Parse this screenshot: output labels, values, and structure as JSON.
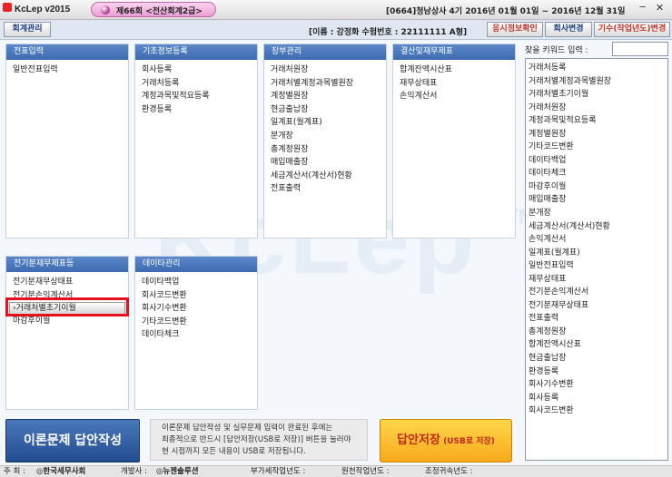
{
  "window": {
    "app_title": "KcLep v2015",
    "exam_tab": "제66회 <전산회계2급>",
    "company_info": "[0664]청남상사 4기 2016년 01월 01일 ~ 2016년 12월 31일",
    "minimize_symbol": "─",
    "close_symbol": "✕"
  },
  "toolbar": {
    "mgmt_button": "회계관리",
    "user_info": "[이름 : 강정화  수험번호 : 22111111  A형]",
    "applicant_button": "응시정보확인",
    "company_button": "회사변경",
    "period_button": "기수(작업년도)변경"
  },
  "panels": {
    "voucher": {
      "title": "전표입력",
      "items": [
        "일반전표입력"
      ]
    },
    "basic": {
      "title": "기초정보등록",
      "items": [
        "회사등록",
        "거래처등록",
        "계정과목및적요등록",
        "환경등록"
      ]
    },
    "ledger": {
      "title": "장부관리",
      "items": [
        "거래처원장",
        "거래처별계정과목별원장",
        "계정별원장",
        "현금출납장",
        "일계표(월계표)",
        "분개장",
        "총계정원장",
        "매입매출장",
        "세금계산서(계산서)현황",
        "전표출력"
      ]
    },
    "closing": {
      "title": "결산및재무제표",
      "items": [
        "합계잔액시산표",
        "재무상태표",
        "손익계산서"
      ]
    },
    "prior": {
      "title": "전기분재무제표등",
      "items": [
        "전기분재무상태표",
        "전기분손익계산서",
        "›거래처별초기이월",
        "마감후이월"
      ]
    },
    "data": {
      "title": "데이타관리",
      "items": [
        "데이타백업",
        "회사코드변환",
        "회사기수변환",
        "기타코드변환",
        "데이타체크"
      ]
    }
  },
  "watermark": {
    "text": "KcLep",
    "tm": "TM"
  },
  "keyword_search": {
    "label": "찾을 키워드 입력 :",
    "input_value": "",
    "items": [
      "거래처등록",
      "거래처별계정과목별원장",
      "거래처별초기이월",
      "거래처원장",
      "계정과목및적요등록",
      "계정별원장",
      "기타코드변환",
      "데이타백업",
      "데이타체크",
      "마감후이월",
      "매입매출장",
      "분개장",
      "세금계산서(계산서)현황",
      "손익계산서",
      "일계표(월계표)",
      "일반전표입력",
      "재무상태표",
      "전기분손익계산서",
      "전기분재무상태표",
      "전표출력",
      "총계정원장",
      "합계잔액시산표",
      "현금출납장",
      "환경등록",
      "회사기수변환",
      "회사등록",
      "회사코드변환"
    ]
  },
  "bottom": {
    "theory_button": "이론문제 답안작성",
    "notice_lines": [
      "이론문제 답안작성 및 실무문제 입력이 완료된 후에는",
      "최종적으로 반드시 [답안저장(USB로 저장)] 버튼을 눌러야",
      "현 시점까지 모든 내용이 USB로 저장됩니다."
    ],
    "save_button_main": "답안저장",
    "save_button_sub": "(USB로 저장)"
  },
  "status": {
    "host_label": "주 최 :",
    "host_value": "◎한국세무사회",
    "developer_label": "개발사 :",
    "developer_value": "◎뉴젠솔루션",
    "vat_year_label": "부가세작업년도 :",
    "source_year_label": "원천작업년도 :",
    "adjust_year_label": "조정귀속년도 :"
  }
}
